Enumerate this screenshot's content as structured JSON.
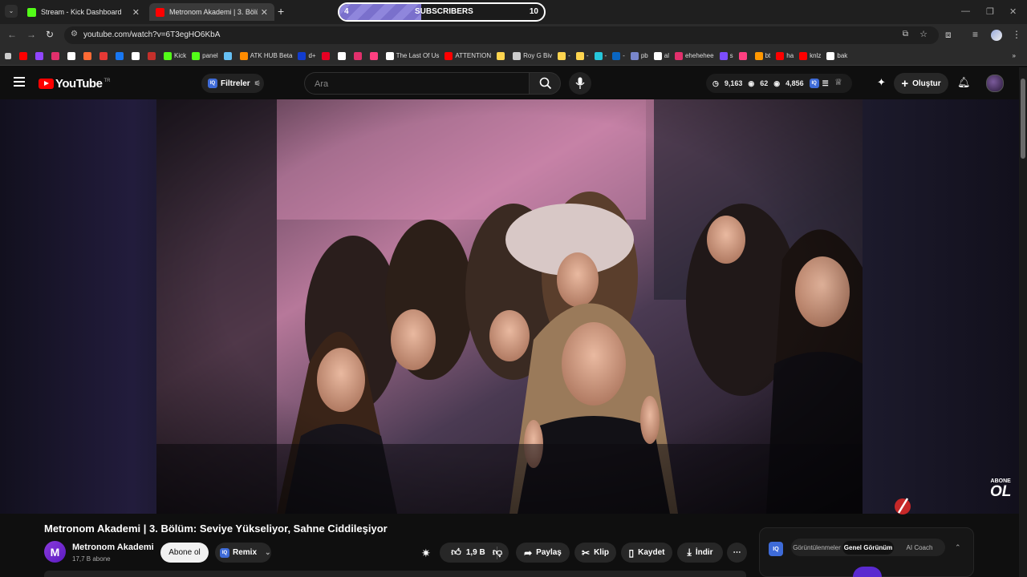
{
  "tabs": [
    {
      "label": "Stream - Kick Dashboard",
      "favicon_color": "#53fc18"
    },
    {
      "label": "Metronom Akademi | 3. Bölüm",
      "favicon_color": "#ff0000"
    }
  ],
  "sub_goal": {
    "current": "4",
    "label": "SUBSCRIBERS",
    "target": "10",
    "progress": 0.4
  },
  "address": {
    "url": "youtube.com/watch?v=6T3egHO6KbA"
  },
  "bookmarks": [
    {
      "label": "",
      "color": "#ff0000"
    },
    {
      "label": "",
      "color": "#9146ff"
    },
    {
      "label": "",
      "color": "#e1306c"
    },
    {
      "label": "",
      "color": "#ffffff"
    },
    {
      "label": "",
      "color": "#ff6b35"
    },
    {
      "label": "",
      "color": "#e53935"
    },
    {
      "label": "",
      "color": "#1877f2"
    },
    {
      "label": "",
      "color": "#ffffff"
    },
    {
      "label": "",
      "color": "#c4302b"
    },
    {
      "label": "Kick",
      "color": "#53fc18"
    },
    {
      "label": "panel",
      "color": "#53fc18"
    },
    {
      "label": "",
      "color": "#66c0f4"
    },
    {
      "label": "ATK HUB Beta",
      "color": "#ff8c00"
    },
    {
      "label": "d+",
      "color": "#113ccf"
    },
    {
      "label": "",
      "color": "#e60023"
    },
    {
      "label": "",
      "color": "#ffffff"
    },
    {
      "label": "",
      "color": "#e1306c"
    },
    {
      "label": "",
      "color": "#ff4081"
    },
    {
      "label": "The Last Of Us",
      "color": "#ffffff"
    },
    {
      "label": "ATTENTION",
      "color": "#ff0000"
    },
    {
      "label": "",
      "color": "#ffd54f"
    },
    {
      "label": "Roy G Biv",
      "color": "#cccccc"
    },
    {
      "label": "-",
      "color": "#ffd54f"
    },
    {
      "label": "-",
      "color": "#ffd54f"
    },
    {
      "label": "-",
      "color": "#26c6da"
    },
    {
      "label": "-",
      "color": "#0a66c2"
    },
    {
      "label": "pb",
      "color": "#7986cb"
    },
    {
      "label": "al",
      "color": "#ffffff"
    },
    {
      "label": "ehehehee",
      "color": "#e1306c"
    },
    {
      "label": "s",
      "color": "#7c4dff"
    },
    {
      "label": "",
      "color": "#ff4081"
    },
    {
      "label": "bt",
      "color": "#ff9800"
    },
    {
      "label": "ha",
      "color": "#ff0000"
    },
    {
      "label": "knlz",
      "color": "#ff0000"
    },
    {
      "label": "bak",
      "color": "#ffffff"
    }
  ],
  "youtube": {
    "logo_text": "YouTube",
    "country": "TR",
    "filters_label": "Filtreler",
    "search_placeholder": "Ara",
    "stats": {
      "views": "9,163",
      "watching": "62",
      "extra": "4,856"
    },
    "create_label": "Oluştur"
  },
  "video": {
    "title": "Metronom Akademi | 3. Bölüm: Seviye Yükseliyor, Sahne Ciddileşiyor",
    "overlay_small": "ABONE",
    "overlay_big": "OL"
  },
  "channel": {
    "initial": "M",
    "name": "Metronom Akademi",
    "subs": "17,7 B abone"
  },
  "actions": {
    "subscribe": "Abone ol",
    "remix": "Remix",
    "likes": "1,9 B",
    "share": "Paylaş",
    "clip": "Klip",
    "save": "Kaydet",
    "download": "İndir"
  },
  "side_panel": {
    "tabs": [
      "Görüntülenmeler",
      "Genel Görünüm",
      "AI Coach"
    ],
    "active": "Genel Görünüm"
  }
}
